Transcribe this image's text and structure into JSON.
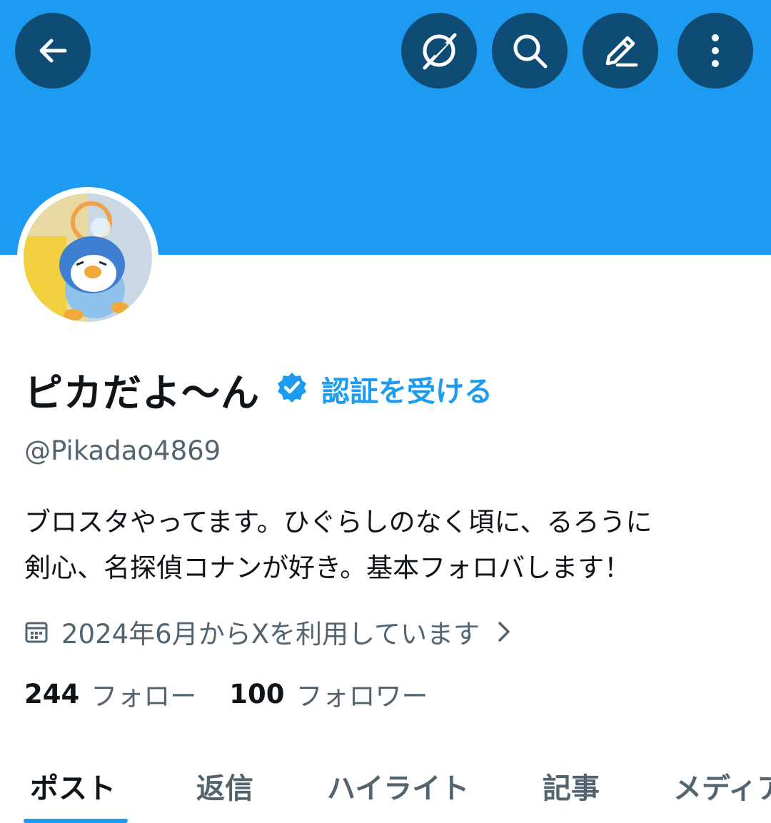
{
  "colors": {
    "banner": "#1d9bf0",
    "button_bg": "#0f4c75",
    "accent": "#1d9bf0",
    "text_primary": "#0f1419",
    "text_secondary": "#536471"
  },
  "header": {
    "icons": [
      "arrow-left-icon",
      "grok-icon",
      "search-icon",
      "edit-icon",
      "more-vertical-icon"
    ]
  },
  "profile": {
    "display_name": "ピカだよ〜ん",
    "get_verified_label": "認証を受ける",
    "handle": "@Pikadao4869",
    "bio_lines": [
      "ブロスタやってます。ひぐらしのなく頃に、るろうに",
      "剣心、名探偵コナンが好き。基本フォロバします！"
    ],
    "joined": "2024年6月からXを利用しています",
    "following_count": "244",
    "following_label": "フォロー",
    "followers_count": "100",
    "followers_label": "フォロワー"
  },
  "tabs": [
    {
      "label": "ポスト",
      "active": true
    },
    {
      "label": "返信",
      "active": false
    },
    {
      "label": "ハイライト",
      "active": false
    },
    {
      "label": "記事",
      "active": false
    },
    {
      "label": "メディア",
      "active": false
    }
  ]
}
